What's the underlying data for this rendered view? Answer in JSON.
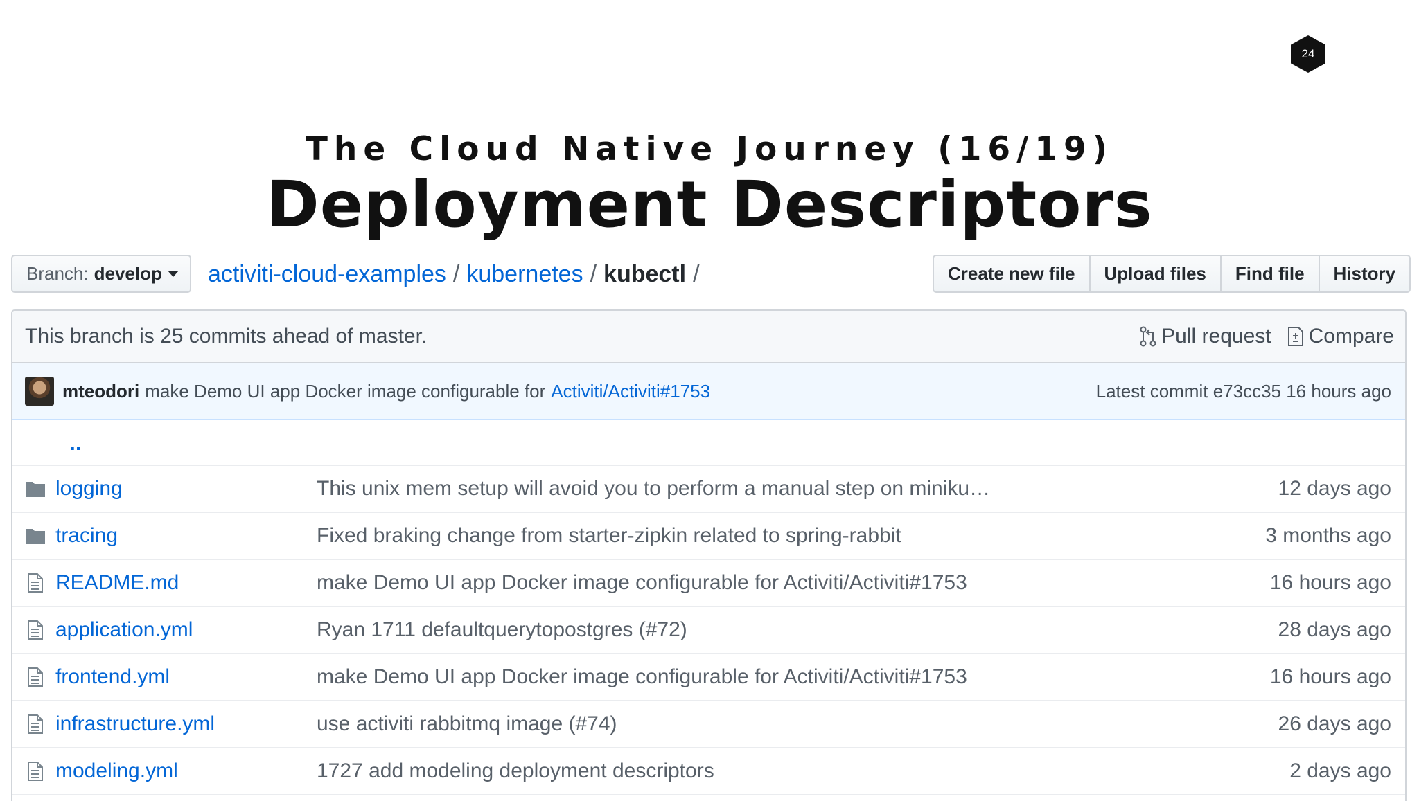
{
  "slide": {
    "page_number": "24",
    "subtitle": "The Cloud Native Journey (16/19)",
    "title": "Deployment Descriptors"
  },
  "toolbar": {
    "branch_label": "Branch:",
    "branch_name": "develop",
    "breadcrumb": {
      "repo": "activiti-cloud-examples",
      "folder": "kubernetes",
      "current": "kubectl",
      "separator": "/"
    },
    "buttons": {
      "create_new_file": "Create new file",
      "upload_files": "Upload files",
      "find_file": "Find file",
      "history": "History"
    }
  },
  "branch_info": {
    "text": "This branch is 25 commits ahead of master.",
    "pull_request": "Pull request",
    "compare": "Compare"
  },
  "latest_commit": {
    "author": "mteodori",
    "message": "make Demo UI app Docker image configurable for",
    "issue_link": "Activiti/Activiti#1753",
    "meta": "Latest commit e73cc35 16 hours ago"
  },
  "up_dir": "..",
  "files": [
    {
      "type": "folder",
      "name": "logging",
      "message": "This unix mem setup will avoid you to perform a manual step on miniku…",
      "age": "12 days ago"
    },
    {
      "type": "folder",
      "name": "tracing",
      "message": "Fixed braking change from starter-zipkin related to spring-rabbit",
      "age": "3 months ago"
    },
    {
      "type": "file",
      "name": "README.md",
      "message": "make Demo UI app Docker image configurable for Activiti/Activiti#1753",
      "age": "16 hours ago"
    },
    {
      "type": "file",
      "name": "application.yml",
      "message": "Ryan 1711 defaultquerytopostgres (#72)",
      "age": "28 days ago"
    },
    {
      "type": "file",
      "name": "frontend.yml",
      "message": "make Demo UI app Docker image configurable for Activiti/Activiti#1753",
      "age": "16 hours ago"
    },
    {
      "type": "file",
      "name": "infrastructure.yml",
      "message": "use activiti rabbitmq image (#74)",
      "age": "26 days ago"
    },
    {
      "type": "file",
      "name": "modeling.yml",
      "message": "1727 add modeling deployment descriptors",
      "age": "2 days ago"
    }
  ]
}
